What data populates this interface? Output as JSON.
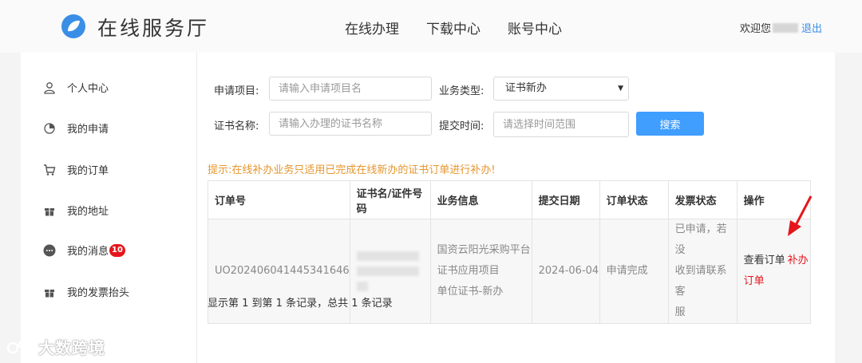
{
  "header": {
    "brand": "在线服务厅",
    "nav": [
      "在线办理",
      "下载中心",
      "账号中心"
    ],
    "welcome": "欢迎您",
    "logout": "退出"
  },
  "sidebar": {
    "items": [
      {
        "label": "个人中心",
        "icon": "user-icon"
      },
      {
        "label": "我的申请",
        "icon": "apply-icon"
      },
      {
        "label": "我的订单",
        "icon": "cart-icon"
      },
      {
        "label": "我的地址",
        "icon": "gift-icon"
      },
      {
        "label": "我的消息",
        "icon": "message-icon",
        "badge": "10"
      },
      {
        "label": "我的发票抬头",
        "icon": "gift-icon"
      }
    ]
  },
  "form": {
    "project_label": "申请项目:",
    "project_placeholder": "请输入申请项目名",
    "type_label": "业务类型:",
    "type_value": "证书新办",
    "cert_label": "证书名称:",
    "cert_placeholder": "请输入办理的证书名称",
    "time_label": "提交时间:",
    "time_placeholder": "请选择时间范围",
    "search_label": "搜索"
  },
  "tip": "提示:在线补办业务只适用已完成在线新办的证书订单进行补办!",
  "table": {
    "headers": [
      "订单号",
      "证书名/证件号码",
      "业务信息",
      "提交日期",
      "订单状态",
      "发票状态",
      "操作"
    ],
    "rows": [
      {
        "order_no": "UO202406041445341646",
        "biz_line1": "国资云阳光采购平台",
        "biz_line2": "证书应用项目",
        "biz_line3": "单位证书-新办",
        "date": "2024-06-04",
        "status": "申请完成",
        "invoice_line1": "已申请，若没",
        "invoice_line2": "收到请联系客",
        "invoice_line3": "服",
        "op_view": "查看订单",
        "op_supplement": "补办订单"
      }
    ]
  },
  "summary": "显示第 1 到第 1 条记录，总共 1 条记录",
  "watermark": "大数跨境",
  "colors": {
    "accent": "#409eff",
    "link": "#3a8ee6",
    "danger": "#e4161c",
    "tip": "#e6962e"
  }
}
